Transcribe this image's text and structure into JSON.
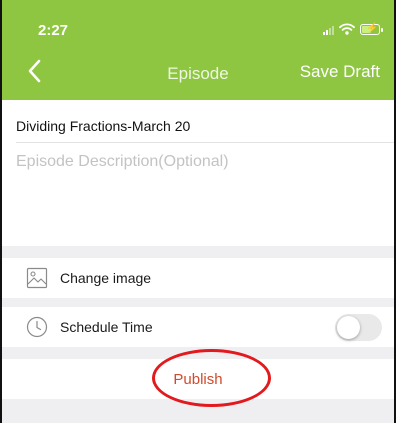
{
  "status_bar": {
    "time": "2:27",
    "icons": [
      "signal-icon",
      "wifi-icon",
      "battery-charging-icon"
    ],
    "battery_level": 0.6
  },
  "nav": {
    "back_icon": "chevron-left-icon",
    "title": "Episode",
    "save_draft_label": "Save Draft"
  },
  "form": {
    "title_value": "Dividing Fractions-March 20",
    "description_placeholder": "Episode Description(Optional)",
    "description_value": ""
  },
  "options": {
    "change_image": {
      "icon": "image-icon",
      "label": "Change image"
    },
    "schedule_time": {
      "icon": "clock-icon",
      "label": "Schedule Time",
      "enabled": false
    }
  },
  "actions": {
    "publish_label": "Publish"
  },
  "colors": {
    "header_green": "#8ec642",
    "publish_text": "#d04a2c",
    "highlight_circle": "#e2191d",
    "background": "#efeff2"
  }
}
